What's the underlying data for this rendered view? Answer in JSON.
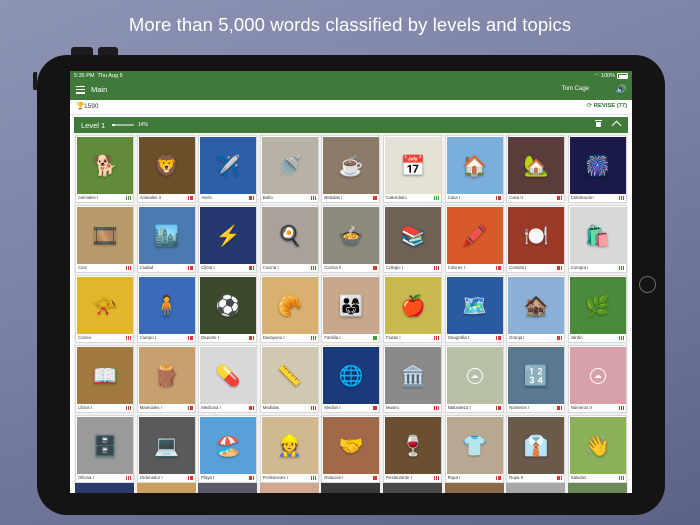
{
  "promo": {
    "headline": "More than 5,000 words classified by levels and topics"
  },
  "status_bar": {
    "time": "5:35 PM",
    "date": "Thu Aug 5",
    "battery": "100%"
  },
  "app_bar": {
    "title": "Main",
    "user": "Tom Cage",
    "menu_icon": "hamburger-menu-icon",
    "speaker_icon": "speaker-icon"
  },
  "score_bar": {
    "points": "1590",
    "revise_label": "REVISE",
    "revise_count": "(77)"
  },
  "level": {
    "title": "Level 1",
    "progress_label": "14%",
    "progress": 0.14
  },
  "colors": {
    "green": "#3f7a3a",
    "dot_red": "#d23a32",
    "dot_green": "#3f9a3a"
  },
  "topics": [
    {
      "label": "Animales I",
      "icon": "🐕",
      "bg": "#5f8b3a",
      "dots": "green"
    },
    {
      "label": "Animales II",
      "icon": "🦁",
      "bg": "#6b4e2a",
      "dots": "red"
    },
    {
      "label": "Avión",
      "icon": "✈️",
      "bg": "#2e5ea8",
      "dots": "red"
    },
    {
      "label": "Baño",
      "icon": "🚿",
      "bg": "#b8b2a6",
      "dots": "red"
    },
    {
      "label": "Bebidas I",
      "icon": "☕",
      "bg": "#8d7b6a",
      "dots": "red"
    },
    {
      "label": "Calendario",
      "icon": "📅",
      "bg": "#e4e2d6",
      "dots": "green"
    },
    {
      "label": "Casa I",
      "icon": "🏠",
      "bg": "#7aaedb",
      "dots": "red"
    },
    {
      "label": "Casa II",
      "icon": "🏡",
      "bg": "#5a3d3a",
      "dots": "red"
    },
    {
      "label": "Celebración",
      "icon": "🎆",
      "bg": "#1a1a4a",
      "dots": "red"
    },
    {
      "label": "Cine",
      "icon": "🎞️",
      "bg": "#b79b6a",
      "dots": "red"
    },
    {
      "label": "Ciudad",
      "icon": "🏙️",
      "bg": "#4a7ab0",
      "dots": "red"
    },
    {
      "label": "Clima I",
      "icon": "⚡",
      "bg": "#243a6e",
      "dots": "red"
    },
    {
      "label": "Cocina I",
      "icon": "🍳",
      "bg": "#a8a29a",
      "dots": "red"
    },
    {
      "label": "Cocina II",
      "icon": "🍲",
      "bg": "#8c8a7a",
      "dots": "red"
    },
    {
      "label": "Colegio I",
      "icon": "📚",
      "bg": "#6e6254",
      "dots": "red"
    },
    {
      "label": "Colores I",
      "icon": "🖍️",
      "bg": "#d65a2a",
      "dots": "red"
    },
    {
      "label": "Comida I",
      "icon": "🍽️",
      "bg": "#9c3a2a",
      "dots": "red"
    },
    {
      "label": "Compra I",
      "icon": "🛍️",
      "bg": "#d8d8d8",
      "dots": "red"
    },
    {
      "label": "Correo",
      "icon": "📯",
      "bg": "#e2b52a",
      "dots": "red"
    },
    {
      "label": "Cuerpo I",
      "icon": "🧍",
      "bg": "#3a6ab8",
      "dots": "red"
    },
    {
      "label": "Deporte I",
      "icon": "⚽",
      "bg": "#3a4a2a",
      "dots": "red"
    },
    {
      "label": "Desayuno I",
      "icon": "🥐",
      "bg": "#d8b070",
      "dots": "red"
    },
    {
      "label": "Familia I",
      "icon": "👨‍👩‍👧",
      "bg": "#c8a88a",
      "dots": "green"
    },
    {
      "label": "Frutas I",
      "icon": "🍎",
      "bg": "#c8b850",
      "dots": "red"
    },
    {
      "label": "Geografía I",
      "icon": "🗺️",
      "bg": "#2a5aa0",
      "dots": "red"
    },
    {
      "label": "Granja I",
      "icon": "🏚️",
      "bg": "#8ab0d8",
      "dots": "red"
    },
    {
      "label": "Jardín",
      "icon": "🌿",
      "bg": "#4a8a3a",
      "dots": "red"
    },
    {
      "label": "Libros I",
      "icon": "📖",
      "bg": "#a07840",
      "dots": "red"
    },
    {
      "label": "Materiales I",
      "icon": "🪵",
      "bg": "#c8a070",
      "dots": "red"
    },
    {
      "label": "Medicina I",
      "icon": "💊",
      "bg": "#d8d8d8",
      "dots": "red"
    },
    {
      "label": "Medidas",
      "icon": "📏",
      "bg": "#d0c8b0",
      "dots": "red"
    },
    {
      "label": "Medios I",
      "icon": "🌐",
      "bg": "#1a3a7a",
      "dots": "red"
    },
    {
      "label": "Museo",
      "icon": "🏛️",
      "bg": "#8a8a8a",
      "dots": "red"
    },
    {
      "label": "Naturaleza I",
      "icon": "",
      "bg": "#b8c0a8",
      "dots": "red",
      "cloud": true
    },
    {
      "label": "Números I",
      "icon": "🔢",
      "bg": "#5a7890",
      "dots": "red"
    },
    {
      "label": "Números II",
      "icon": "",
      "bg": "#d8a0a8",
      "dots": "red",
      "cloud": true
    },
    {
      "label": "Oficina I",
      "icon": "🗄️",
      "bg": "#9a9a9a",
      "dots": "red"
    },
    {
      "label": "Ordenador I",
      "icon": "💻",
      "bg": "#5a5a5a",
      "dots": "red"
    },
    {
      "label": "Playa I",
      "icon": "🏖️",
      "bg": "#5aa0d8",
      "dots": "red"
    },
    {
      "label": "Profesiones I",
      "icon": "👷",
      "bg": "#d0b890",
      "dots": "red"
    },
    {
      "label": "Relación I",
      "icon": "🤝",
      "bg": "#a06a4a",
      "dots": "red"
    },
    {
      "label": "Restaurante I",
      "icon": "🍷",
      "bg": "#6a5030",
      "dots": "red"
    },
    {
      "label": "Ropa I",
      "icon": "👕",
      "bg": "#b8a890",
      "dots": "red"
    },
    {
      "label": "Ropa II",
      "icon": "👔",
      "bg": "#6a5a4a",
      "dots": "red"
    },
    {
      "label": "Saludos",
      "icon": "👋",
      "bg": "#8ab05a",
      "dots": "red"
    }
  ],
  "partial_row_colors": [
    "#2a3a6a",
    "#c8a060",
    "#5a5a6a",
    "#d0a890",
    "#3a3a3a",
    "#4a4a4a",
    "#8a6a4a",
    "#a8a8a8",
    "#6a8a5a"
  ]
}
